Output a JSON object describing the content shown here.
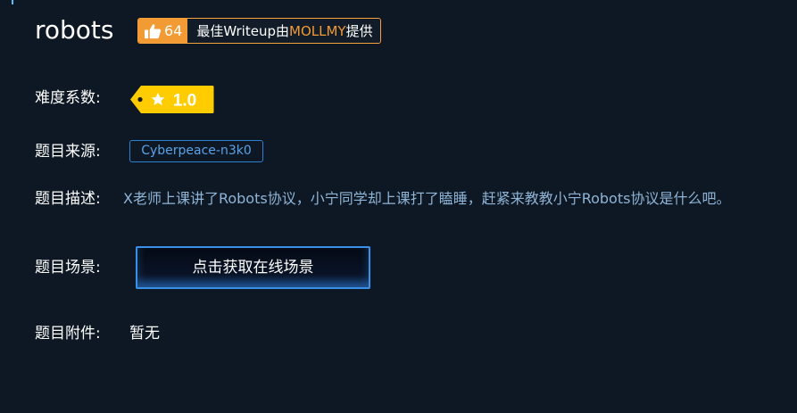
{
  "challenge": {
    "title": "robots",
    "likes": "64",
    "writeup_prefix": "最佳Writeup由",
    "writeup_author": "MOLLMY",
    "writeup_suffix": "提供"
  },
  "fields": {
    "difficulty_label": "难度系数:",
    "difficulty_value": "1.0",
    "source_label": "题目来源:",
    "source_value": "Cyberpeace-n3k0",
    "description_label": "题目描述:",
    "description_value": "X老师上课讲了Robots协议，小宁同学却上课打了瞌睡，赶紧来教教小宁Robots协议是什么吧。",
    "scene_label": "题目场景:",
    "scene_button": "点击获取在线场景",
    "attachment_label": "题目附件:",
    "attachment_value": "暂无"
  },
  "colors": {
    "background": "#0d1824",
    "accent_orange": "#f29a33",
    "tag_yellow": "#ffcc00",
    "link_blue": "#5aa2e8",
    "description_text": "#8fb4d6",
    "button_border": "#3a8fe6"
  },
  "icons": {
    "like": "thumbs-up-icon",
    "difficulty": "star-icon"
  }
}
